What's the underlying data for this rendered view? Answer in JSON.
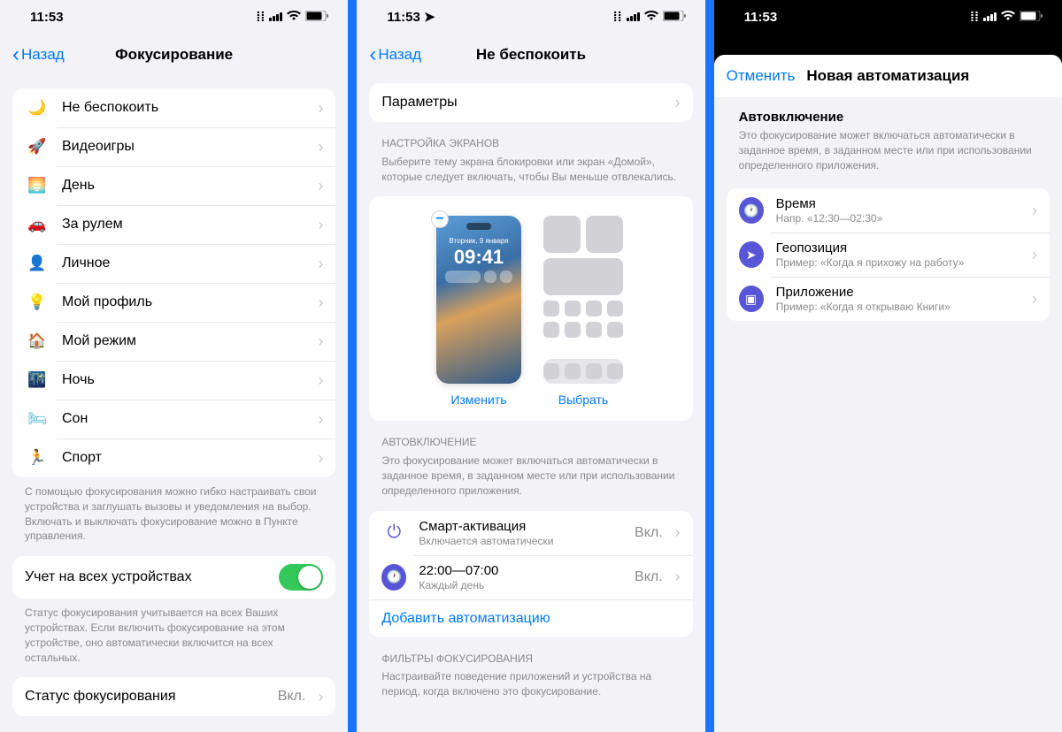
{
  "statusbar": {
    "time": "11:53"
  },
  "p1": {
    "back": "Назад",
    "title": "Фокусирование",
    "modes": [
      {
        "icon": "🌙",
        "color": "#5856d6",
        "label": "Не беспокоить"
      },
      {
        "icon": "🚀",
        "color": "#0079ff",
        "label": "Видеоигры"
      },
      {
        "icon": "🌅",
        "color": "#ff9500",
        "label": "День"
      },
      {
        "icon": "🚗",
        "color": "#5856d6",
        "label": "За рулем"
      },
      {
        "icon": "👤",
        "color": "#af52de",
        "label": "Личное"
      },
      {
        "icon": "💡",
        "color": "#ff9500",
        "label": "Мой профиль"
      },
      {
        "icon": "🏠",
        "color": "#0079ff",
        "label": "Мой режим"
      },
      {
        "icon": "🌃",
        "color": "#0079ff",
        "label": "Ночь"
      },
      {
        "icon": "🛏",
        "color": "#30b0c7",
        "label": "Сон"
      },
      {
        "icon": "🏃",
        "color": "#34c759",
        "label": "Спорт"
      }
    ],
    "modes_footer": "С помощью фокусирования можно гибко настраивать свои устройства и заглушать вызовы и уведомления на выбор. Включать и выключать фокусирование можно в Пункте управления.",
    "sync_label": "Учет на всех устройствах",
    "sync_footer": "Статус фокусирования учитывается на всех Ваших устройствах. Если включить фокусирование на этом устройстве, оно автоматически включится на всех остальных.",
    "status_label": "Статус фокусирования",
    "status_val": "Вкл."
  },
  "p2": {
    "back": "Назад",
    "title": "Не беспокоить",
    "params": "Параметры",
    "screens_hdr": "НАСТРОЙКА ЭКРАНОВ",
    "screens_desc": "Выберите тему экрана блокировки или экран «Домой», которые следует включать, чтобы Вы меньше отвлекались.",
    "lock_date": "Вторник, 9 января",
    "lock_time": "09:41",
    "change": "Изменить",
    "choose": "Выбрать",
    "auto_hdr": "АВТОВКЛЮЧЕНИЕ",
    "auto_desc": "Это фокусирование может включаться автоматически в заданное время, в заданном месте или при использовании определенного приложения.",
    "smart_label": "Смарт-активация",
    "smart_sub": "Включается автоматически",
    "smart_val": "Вкл.",
    "sched_label": "22:00—07:00",
    "sched_sub": "Каждый день",
    "sched_val": "Вкл.",
    "add_auto": "Добавить автоматизацию",
    "filters_hdr": "ФИЛЬТРЫ ФОКУСИРОВАНИЯ",
    "filters_desc": "Настраивайте поведение приложений и устройства на период, когда включено это фокусирование."
  },
  "p3": {
    "cancel": "Отменить",
    "title": "Новая автоматизация",
    "hdr": "Автовключение",
    "desc": "Это фокусирование может включаться автоматически в заданное время, в заданном месте или при использовании определенного приложения.",
    "items": [
      {
        "icon": "clock",
        "label": "Время",
        "sub": "Напр. «12:30—02:30»"
      },
      {
        "icon": "nav",
        "label": "Геопозиция",
        "sub": "Пример: «Когда я прихожу на работу»"
      },
      {
        "icon": "app",
        "label": "Приложение",
        "sub": "Пример: «Когда я открываю Книги»"
      }
    ]
  }
}
